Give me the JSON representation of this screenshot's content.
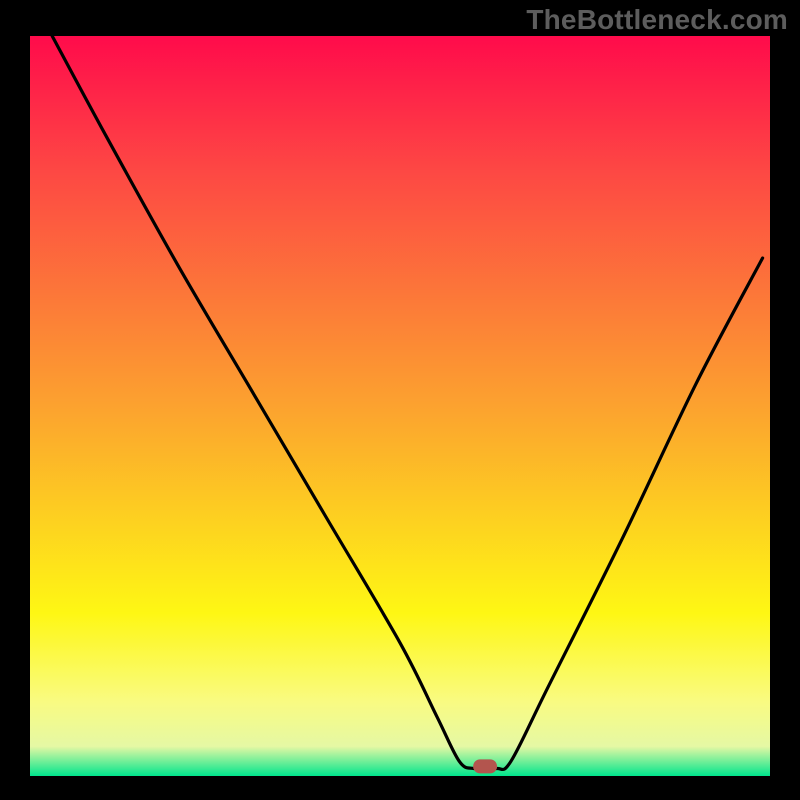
{
  "watermark": "TheBottleneck.com",
  "chart_data": {
    "type": "line",
    "title": "",
    "xlabel": "",
    "ylabel": "",
    "xlim": [
      0,
      100
    ],
    "ylim": [
      0,
      100
    ],
    "series": [
      {
        "name": "bottleneck-curve",
        "x": [
          3,
          10,
          20,
          30,
          40,
          50,
          55,
          58,
          60,
          63,
          65,
          70,
          80,
          90,
          99
        ],
        "values": [
          100,
          87,
          69,
          52,
          35,
          18,
          8,
          2,
          1,
          1,
          2,
          12,
          32,
          53,
          70
        ]
      }
    ],
    "marker": {
      "x": 61.5,
      "y": 1.3
    },
    "colors": {
      "frame": "#000000",
      "curve": "#000000",
      "marker": "#b3554e",
      "gradient_top": "#ff0b4b",
      "gradient_red": "#fd4744",
      "gradient_orange": "#fca22f",
      "gradient_yellow": "#fef714",
      "gradient_pale": "#f9fb82",
      "gradient_pale2": "#e5f8a4",
      "gradient_green": "#00e58d"
    }
  }
}
